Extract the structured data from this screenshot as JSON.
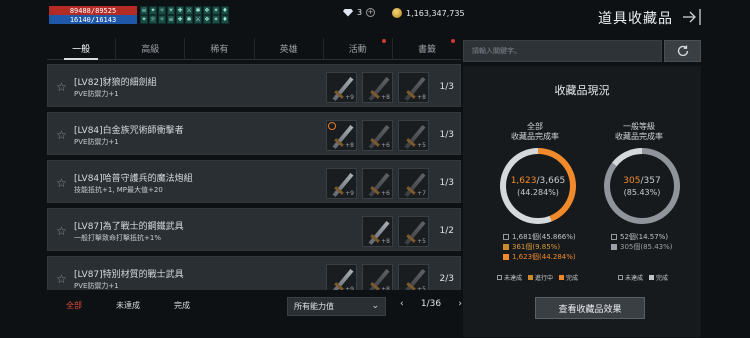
{
  "status": {
    "hp": "89488/89525",
    "mp": "16140/16143",
    "buffs": [
      "☠",
      "✦",
      "✧",
      "☀",
      "✚",
      "⚔",
      "✱",
      "❖",
      "✶",
      "♦",
      "✦",
      "☼",
      "✧",
      "☠",
      "✚",
      "✱",
      "⚔",
      "❖",
      "✶",
      "♦"
    ]
  },
  "currency": {
    "gems": "3",
    "gold": "1,163,347,735"
  },
  "header": {
    "title": "道具收藏品"
  },
  "tabs": [
    {
      "label": "一般",
      "active": true,
      "badge": false
    },
    {
      "label": "高級",
      "active": false,
      "badge": false
    },
    {
      "label": "稀有",
      "active": false,
      "badge": false
    },
    {
      "label": "英雄",
      "active": false,
      "badge": false
    },
    {
      "label": "活動",
      "active": false,
      "badge": true
    },
    {
      "label": "書籤",
      "active": false,
      "badge": true
    }
  ],
  "rows": [
    {
      "name": "[LV82]豺狼的細劍組",
      "desc": "PVE防禦力+1",
      "count": "1/3",
      "slots": [
        {
          "lv": "+9"
        },
        {
          "lv": "+8"
        },
        {
          "lv": "+8"
        }
      ]
    },
    {
      "name": "[LV84]白金族咒術師衝擊者",
      "desc": "PVE防禦力+1",
      "count": "1/3",
      "slots": [
        {
          "lv": "+8"
        },
        {
          "lv": "+6"
        },
        {
          "lv": "+5"
        }
      ]
    },
    {
      "name": "[LV84]哈普守護兵的魔法炮組",
      "desc": "技能抵抗+1, MP最大值+20",
      "count": "1/3",
      "slots": [
        {
          "lv": "+9"
        },
        {
          "lv": "+6"
        },
        {
          "lv": "+7"
        }
      ]
    },
    {
      "name": "[LV87]為了戰士的鋼鐵武具",
      "desc": "一般打擊致命打擊抵抗+1%",
      "count": "1/2",
      "slots": [
        {
          "lv": "+8"
        },
        {
          "lv": "+5"
        }
      ]
    },
    {
      "name": "[LV87]特別材質的戰士武具",
      "desc": "PVE防禦力+1",
      "count": "2/3",
      "slots": [
        {
          "lv": "+9"
        },
        {
          "lv": "+8"
        },
        {
          "lv": "+5"
        }
      ]
    }
  ],
  "filters": [
    {
      "label": "全部",
      "active": true
    },
    {
      "label": "未達成",
      "active": false
    },
    {
      "label": "完成",
      "active": false
    }
  ],
  "ability_select": {
    "value": "所有能力值"
  },
  "pager": {
    "text": "1/36"
  },
  "search": {
    "placeholder": "請輸入關鍵字。"
  },
  "panel": {
    "title": "收藏品現況",
    "left": {
      "label1": "全部",
      "label2": "收藏品完成率",
      "done": "1,623",
      "total": "/3,665",
      "percent": "(44.284%)",
      "ratio": 0.44284,
      "stats": [
        "1,681個(45.866%)",
        "361個(9.85%)",
        "1,623個(44.284%)"
      ]
    },
    "right": {
      "label1": "一般等級",
      "label2": "收藏品完成率",
      "done": "305",
      "total": "/357",
      "percent": "(85.43%)",
      "ratio": 0.8543,
      "stats": [
        "52個(14.57%)",
        "305個(85.43%)"
      ]
    },
    "legend_left": [
      "未達成",
      "進行中",
      "完成"
    ],
    "legend_right": [
      "未達成",
      "完成"
    ]
  },
  "effect_button": {
    "label": "查看收藏品效果"
  },
  "colors": {
    "accent": "#f08a2a",
    "hp": "#b42b24",
    "mp": "#1f58a8",
    "red_dot": "#d0382f"
  }
}
